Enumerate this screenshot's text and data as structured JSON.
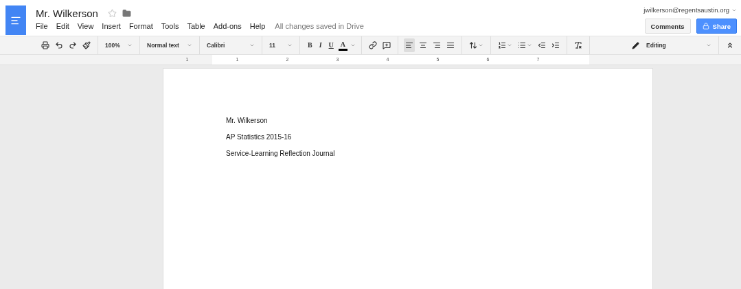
{
  "title": "Mr. Wilkerson",
  "starred": false,
  "menus": [
    "File",
    "Edit",
    "View",
    "Insert",
    "Format",
    "Tools",
    "Table",
    "Add-ons",
    "Help"
  ],
  "save_status": "All changes saved in Drive",
  "account": "jwilkerson@regentsaustin.org",
  "buttons": {
    "comments": "Comments",
    "share": "Share"
  },
  "toolbar": {
    "zoom": "100%",
    "style": "Normal text",
    "font": "Calibri",
    "size": "11",
    "format": [
      {
        "kind": "bold",
        "label": "B"
      },
      {
        "kind": "italic",
        "label": "I"
      },
      {
        "kind": "underline",
        "label": "U"
      },
      {
        "kind": "color",
        "label": "A"
      }
    ],
    "align": [
      {
        "kind": "left",
        "selected": true
      },
      {
        "kind": "center",
        "selected": false
      },
      {
        "kind": "right",
        "selected": false
      },
      {
        "kind": "justify",
        "selected": false
      }
    ],
    "mode": "Editing"
  },
  "ruler": [
    "1",
    "1",
    "2",
    "3",
    "4",
    "5",
    "6",
    "7"
  ],
  "document": [
    "Mr. Wilkerson",
    "AP Statistics 2015-16",
    "Service-Learning Reflection Journal"
  ]
}
